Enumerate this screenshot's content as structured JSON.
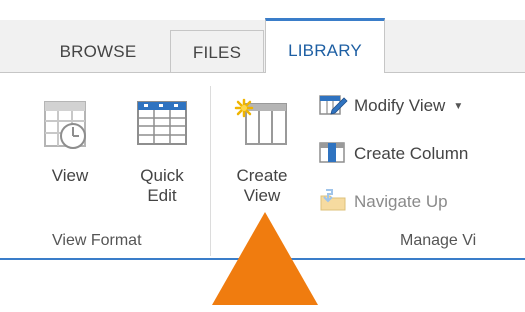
{
  "tabs": [
    {
      "label": "BROWSE"
    },
    {
      "label": "FILES"
    },
    {
      "label": "LIBRARY",
      "active": true
    }
  ],
  "colors": {
    "accent": "#3a7dc9",
    "active_tab_text": "#1e5fa3",
    "arrow": "#f07c0f"
  },
  "view_format": {
    "view_label": "View",
    "quick_edit_line1": "Quick",
    "quick_edit_line2": "Edit",
    "group_label": "View Format"
  },
  "manage_views": {
    "create_view_line1": "Create",
    "create_view_line2": "View",
    "modify_view_label": "Modify View",
    "create_column_label": "Create Column",
    "navigate_up_label": "Navigate Up",
    "group_label": "Manage Vi"
  },
  "icons": {
    "view": "view-icon",
    "quick_edit": "quick-edit-grid-icon",
    "create_view": "create-view-icon",
    "modify_view": "modify-view-icon",
    "create_column": "create-column-icon",
    "navigate_up": "navigate-up-icon",
    "dropdown": "chevron-down-icon",
    "callout": "orange-arrow-pointer"
  }
}
